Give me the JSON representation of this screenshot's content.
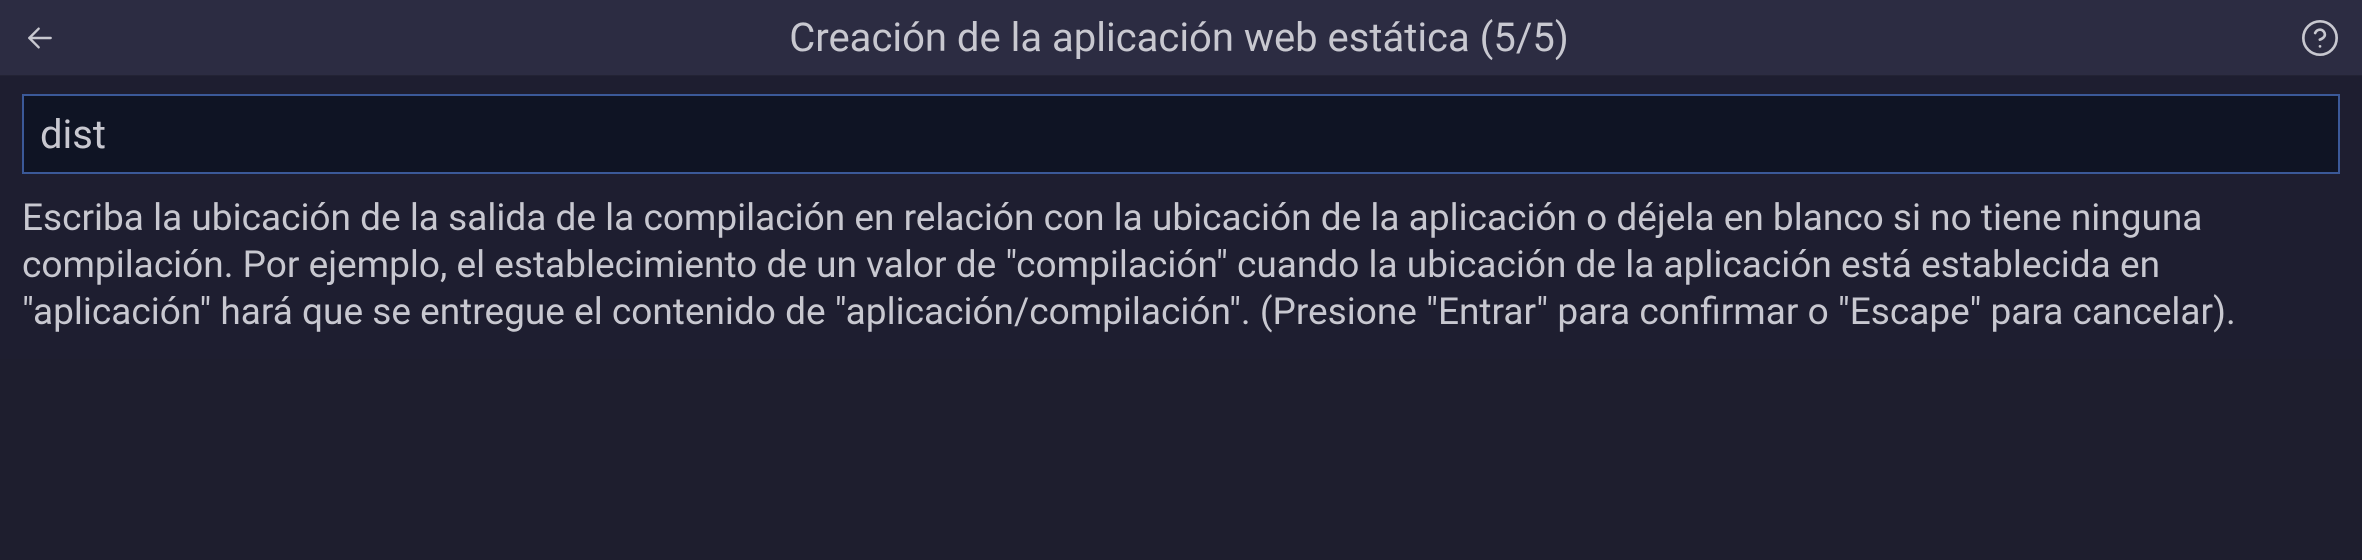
{
  "header": {
    "title": "Creación de la aplicación web estática (5/5)"
  },
  "input": {
    "value": "dist",
    "placeholder": ""
  },
  "description": "Escriba la ubicación de la salida de la compilación en relación con la ubicación de la aplicación o déjela en blanco si no tiene ninguna compilación. Por ejemplo, el establecimiento de un valor de \"compilación\" cuando la ubicación de la aplicación está establecida en \"aplicación\" hará que se entregue el contenido de \"aplicación/compilación\". (Presione \"Entrar\" para confirmar o \"Escape\" para cancelar)."
}
